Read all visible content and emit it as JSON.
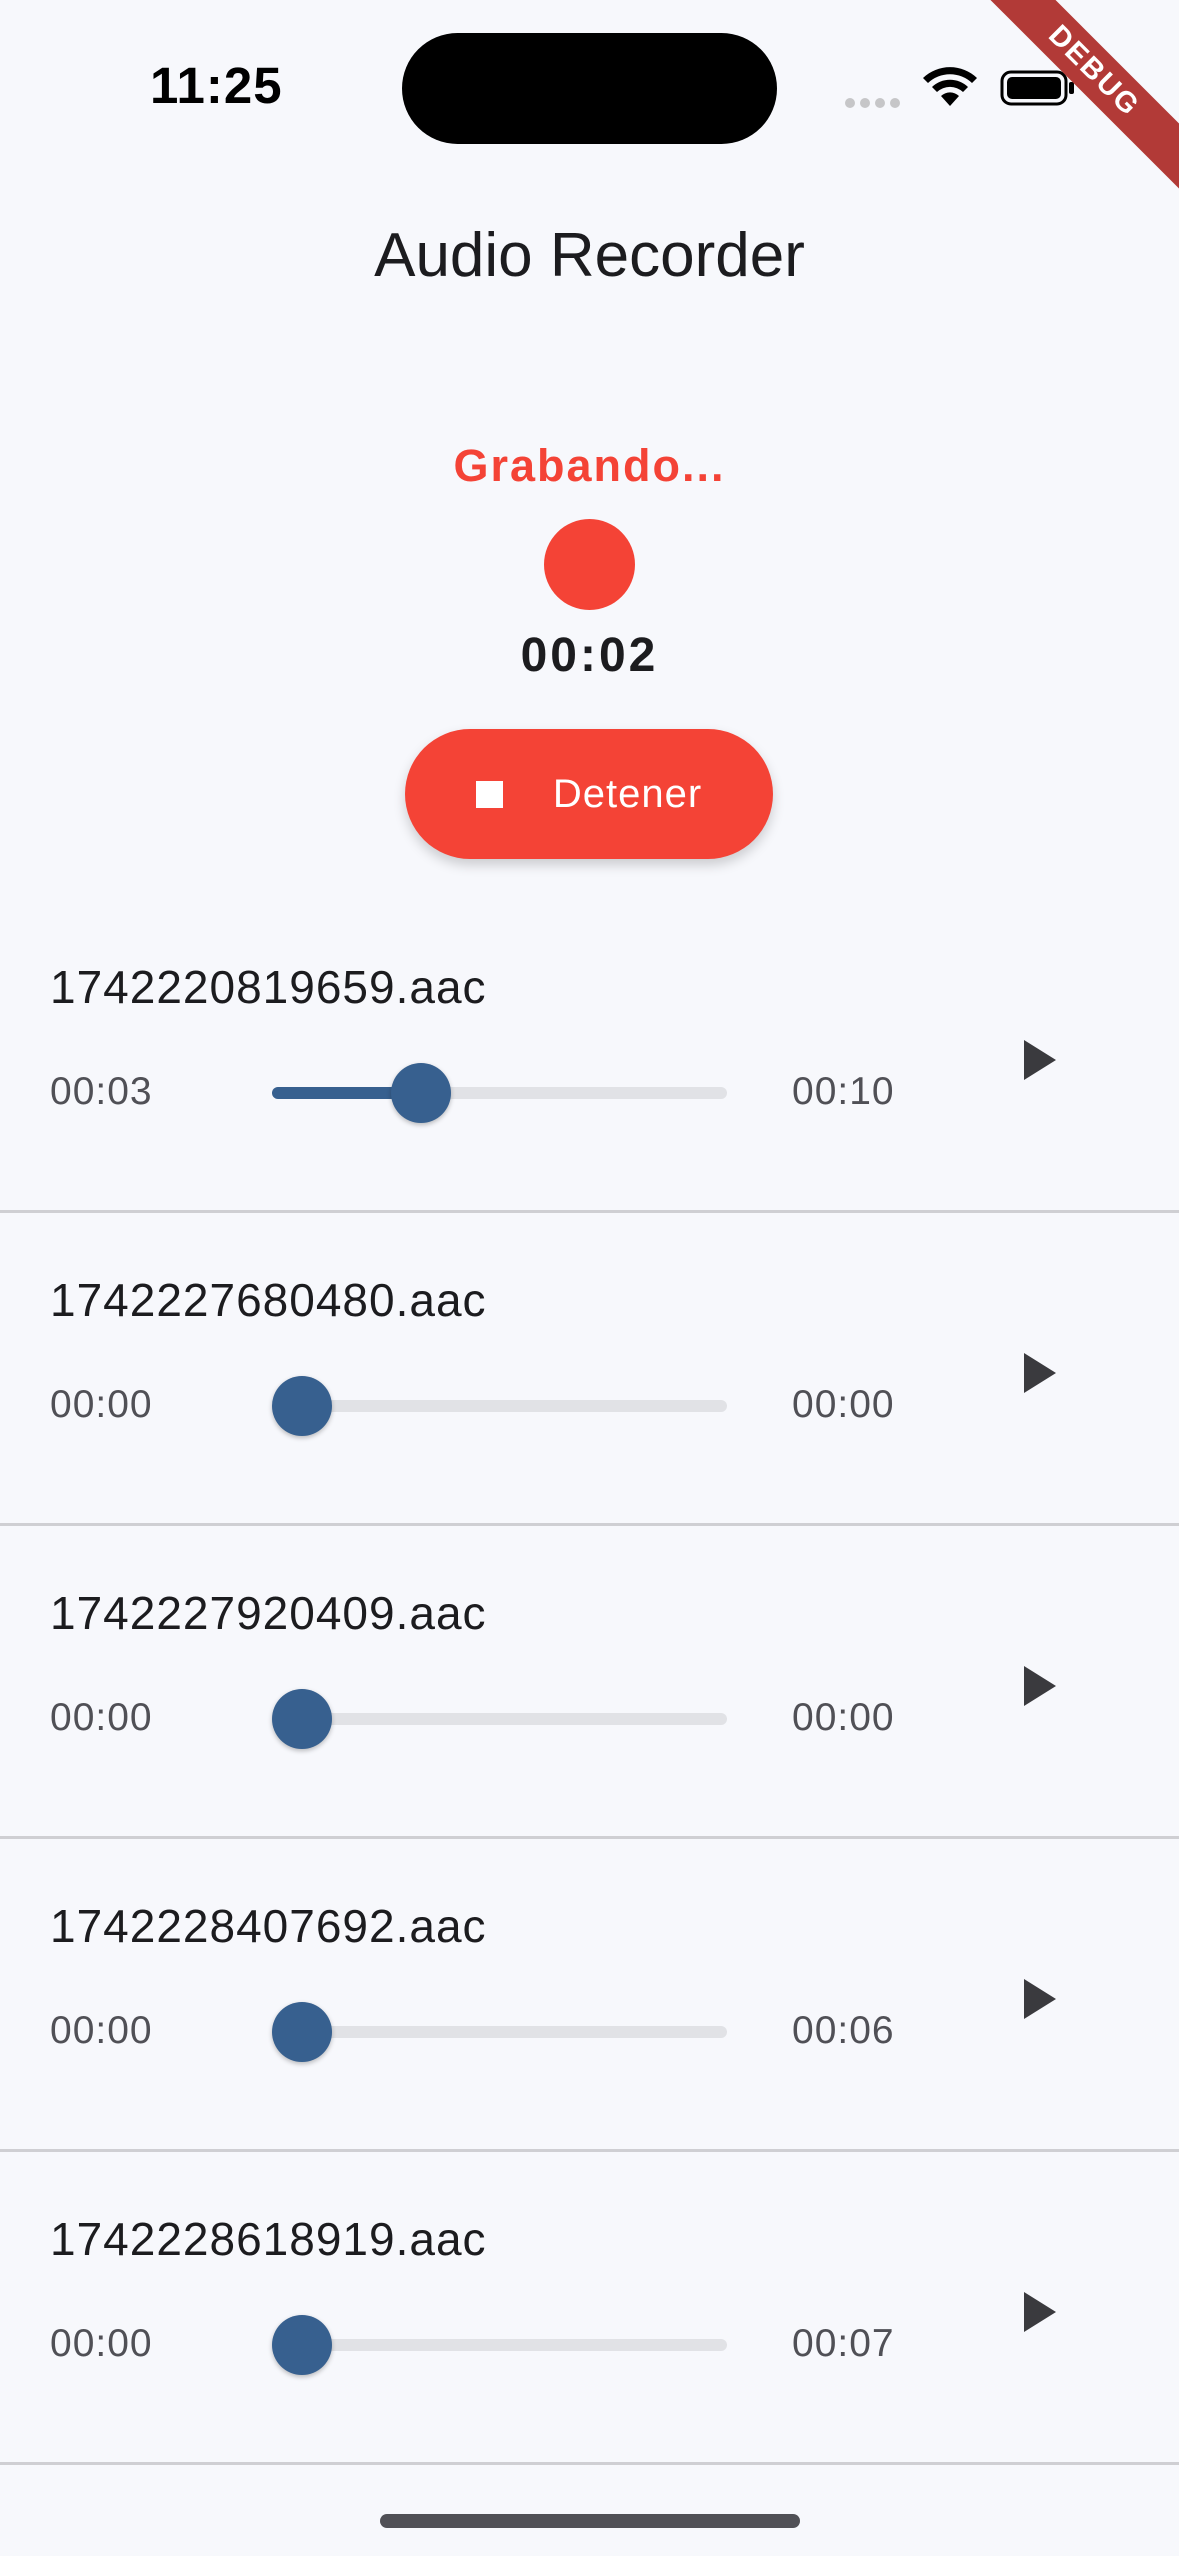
{
  "status_bar": {
    "time": "11:25"
  },
  "debug_banner": "DEBUG",
  "app_title": "Audio Recorder",
  "recording": {
    "status": "Grabando...",
    "elapsed": "00:02",
    "stop_label": "Detener",
    "color": "#f44336"
  },
  "accent_color": "#37608f",
  "recordings": [
    {
      "name": "1742220819659.aac",
      "position": "00:03",
      "duration": "00:10",
      "progress": 0.3
    },
    {
      "name": "1742227680480.aac",
      "position": "00:00",
      "duration": "00:00",
      "progress": 0.0
    },
    {
      "name": "1742227920409.aac",
      "position": "00:00",
      "duration": "00:00",
      "progress": 0.0
    },
    {
      "name": "1742228407692.aac",
      "position": "00:00",
      "duration": "00:06",
      "progress": 0.0
    },
    {
      "name": "1742228618919.aac",
      "position": "00:00",
      "duration": "00:07",
      "progress": 0.0
    }
  ]
}
